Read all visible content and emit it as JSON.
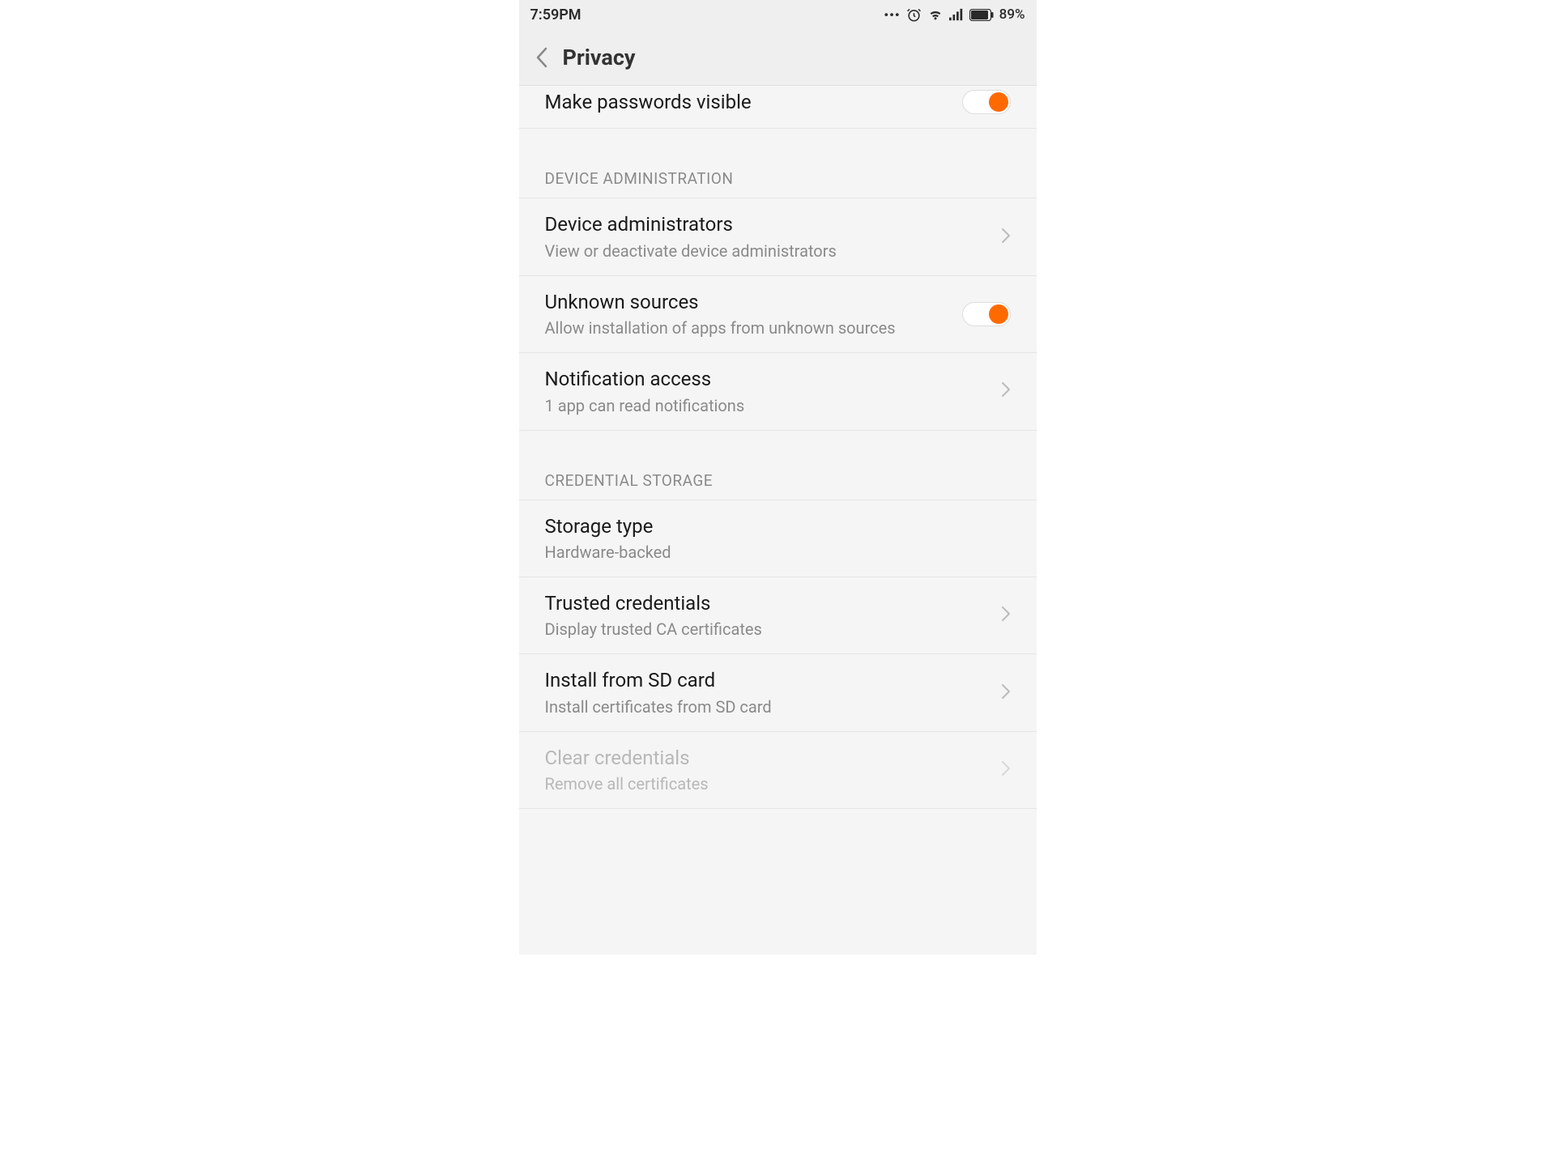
{
  "status_bar": {
    "time": "7:59PM",
    "battery_percent": "89%"
  },
  "header": {
    "title": "Privacy"
  },
  "settings": {
    "passwords": {
      "title": "Make passwords visible",
      "toggle_on": true
    },
    "sections": [
      {
        "header": "DEVICE ADMINISTRATION",
        "items": [
          {
            "key": "device_admins",
            "title": "Device administrators",
            "subtitle": "View or deactivate device administrators",
            "type": "nav"
          },
          {
            "key": "unknown_sources",
            "title": "Unknown sources",
            "subtitle": "Allow installation of apps from unknown sources",
            "type": "toggle",
            "toggle_on": true
          },
          {
            "key": "notification_access",
            "title": "Notification access",
            "subtitle": "1 app can read notifications",
            "type": "nav"
          }
        ]
      },
      {
        "header": "CREDENTIAL STORAGE",
        "items": [
          {
            "key": "storage_type",
            "title": "Storage type",
            "subtitle": "Hardware-backed",
            "type": "info"
          },
          {
            "key": "trusted_credentials",
            "title": "Trusted credentials",
            "subtitle": "Display trusted CA certificates",
            "type": "nav"
          },
          {
            "key": "install_sd",
            "title": "Install from SD card",
            "subtitle": "Install certificates from SD card",
            "type": "nav"
          },
          {
            "key": "clear_credentials",
            "title": "Clear credentials",
            "subtitle": "Remove all certificates",
            "type": "nav",
            "disabled": true
          }
        ]
      }
    ]
  },
  "colors": {
    "accent": "#ff6a00"
  }
}
